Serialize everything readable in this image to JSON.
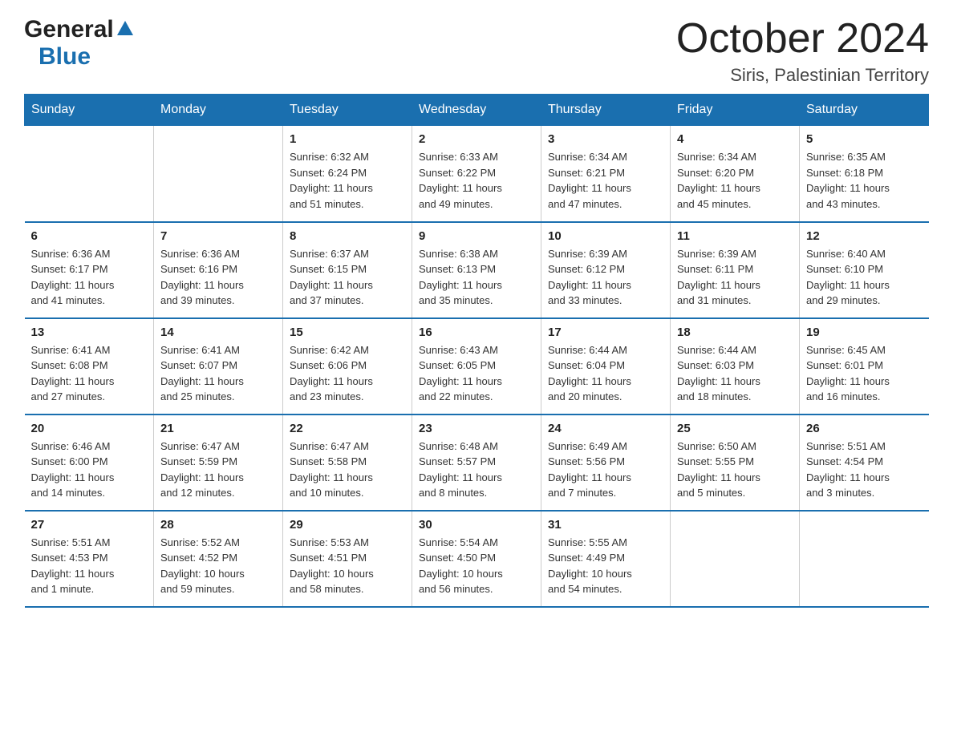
{
  "logo": {
    "general": "General",
    "blue": "Blue",
    "triangle": "▲"
  },
  "title": "October 2024",
  "location": "Siris, Palestinian Territory",
  "headers": [
    "Sunday",
    "Monday",
    "Tuesday",
    "Wednesday",
    "Thursday",
    "Friday",
    "Saturday"
  ],
  "weeks": [
    [
      {
        "day": "",
        "info": ""
      },
      {
        "day": "",
        "info": ""
      },
      {
        "day": "1",
        "info": "Sunrise: 6:32 AM\nSunset: 6:24 PM\nDaylight: 11 hours\nand 51 minutes."
      },
      {
        "day": "2",
        "info": "Sunrise: 6:33 AM\nSunset: 6:22 PM\nDaylight: 11 hours\nand 49 minutes."
      },
      {
        "day": "3",
        "info": "Sunrise: 6:34 AM\nSunset: 6:21 PM\nDaylight: 11 hours\nand 47 minutes."
      },
      {
        "day": "4",
        "info": "Sunrise: 6:34 AM\nSunset: 6:20 PM\nDaylight: 11 hours\nand 45 minutes."
      },
      {
        "day": "5",
        "info": "Sunrise: 6:35 AM\nSunset: 6:18 PM\nDaylight: 11 hours\nand 43 minutes."
      }
    ],
    [
      {
        "day": "6",
        "info": "Sunrise: 6:36 AM\nSunset: 6:17 PM\nDaylight: 11 hours\nand 41 minutes."
      },
      {
        "day": "7",
        "info": "Sunrise: 6:36 AM\nSunset: 6:16 PM\nDaylight: 11 hours\nand 39 minutes."
      },
      {
        "day": "8",
        "info": "Sunrise: 6:37 AM\nSunset: 6:15 PM\nDaylight: 11 hours\nand 37 minutes."
      },
      {
        "day": "9",
        "info": "Sunrise: 6:38 AM\nSunset: 6:13 PM\nDaylight: 11 hours\nand 35 minutes."
      },
      {
        "day": "10",
        "info": "Sunrise: 6:39 AM\nSunset: 6:12 PM\nDaylight: 11 hours\nand 33 minutes."
      },
      {
        "day": "11",
        "info": "Sunrise: 6:39 AM\nSunset: 6:11 PM\nDaylight: 11 hours\nand 31 minutes."
      },
      {
        "day": "12",
        "info": "Sunrise: 6:40 AM\nSunset: 6:10 PM\nDaylight: 11 hours\nand 29 minutes."
      }
    ],
    [
      {
        "day": "13",
        "info": "Sunrise: 6:41 AM\nSunset: 6:08 PM\nDaylight: 11 hours\nand 27 minutes."
      },
      {
        "day": "14",
        "info": "Sunrise: 6:41 AM\nSunset: 6:07 PM\nDaylight: 11 hours\nand 25 minutes."
      },
      {
        "day": "15",
        "info": "Sunrise: 6:42 AM\nSunset: 6:06 PM\nDaylight: 11 hours\nand 23 minutes."
      },
      {
        "day": "16",
        "info": "Sunrise: 6:43 AM\nSunset: 6:05 PM\nDaylight: 11 hours\nand 22 minutes."
      },
      {
        "day": "17",
        "info": "Sunrise: 6:44 AM\nSunset: 6:04 PM\nDaylight: 11 hours\nand 20 minutes."
      },
      {
        "day": "18",
        "info": "Sunrise: 6:44 AM\nSunset: 6:03 PM\nDaylight: 11 hours\nand 18 minutes."
      },
      {
        "day": "19",
        "info": "Sunrise: 6:45 AM\nSunset: 6:01 PM\nDaylight: 11 hours\nand 16 minutes."
      }
    ],
    [
      {
        "day": "20",
        "info": "Sunrise: 6:46 AM\nSunset: 6:00 PM\nDaylight: 11 hours\nand 14 minutes."
      },
      {
        "day": "21",
        "info": "Sunrise: 6:47 AM\nSunset: 5:59 PM\nDaylight: 11 hours\nand 12 minutes."
      },
      {
        "day": "22",
        "info": "Sunrise: 6:47 AM\nSunset: 5:58 PM\nDaylight: 11 hours\nand 10 minutes."
      },
      {
        "day": "23",
        "info": "Sunrise: 6:48 AM\nSunset: 5:57 PM\nDaylight: 11 hours\nand 8 minutes."
      },
      {
        "day": "24",
        "info": "Sunrise: 6:49 AM\nSunset: 5:56 PM\nDaylight: 11 hours\nand 7 minutes."
      },
      {
        "day": "25",
        "info": "Sunrise: 6:50 AM\nSunset: 5:55 PM\nDaylight: 11 hours\nand 5 minutes."
      },
      {
        "day": "26",
        "info": "Sunrise: 5:51 AM\nSunset: 4:54 PM\nDaylight: 11 hours\nand 3 minutes."
      }
    ],
    [
      {
        "day": "27",
        "info": "Sunrise: 5:51 AM\nSunset: 4:53 PM\nDaylight: 11 hours\nand 1 minute."
      },
      {
        "day": "28",
        "info": "Sunrise: 5:52 AM\nSunset: 4:52 PM\nDaylight: 10 hours\nand 59 minutes."
      },
      {
        "day": "29",
        "info": "Sunrise: 5:53 AM\nSunset: 4:51 PM\nDaylight: 10 hours\nand 58 minutes."
      },
      {
        "day": "30",
        "info": "Sunrise: 5:54 AM\nSunset: 4:50 PM\nDaylight: 10 hours\nand 56 minutes."
      },
      {
        "day": "31",
        "info": "Sunrise: 5:55 AM\nSunset: 4:49 PM\nDaylight: 10 hours\nand 54 minutes."
      },
      {
        "day": "",
        "info": ""
      },
      {
        "day": "",
        "info": ""
      }
    ]
  ]
}
